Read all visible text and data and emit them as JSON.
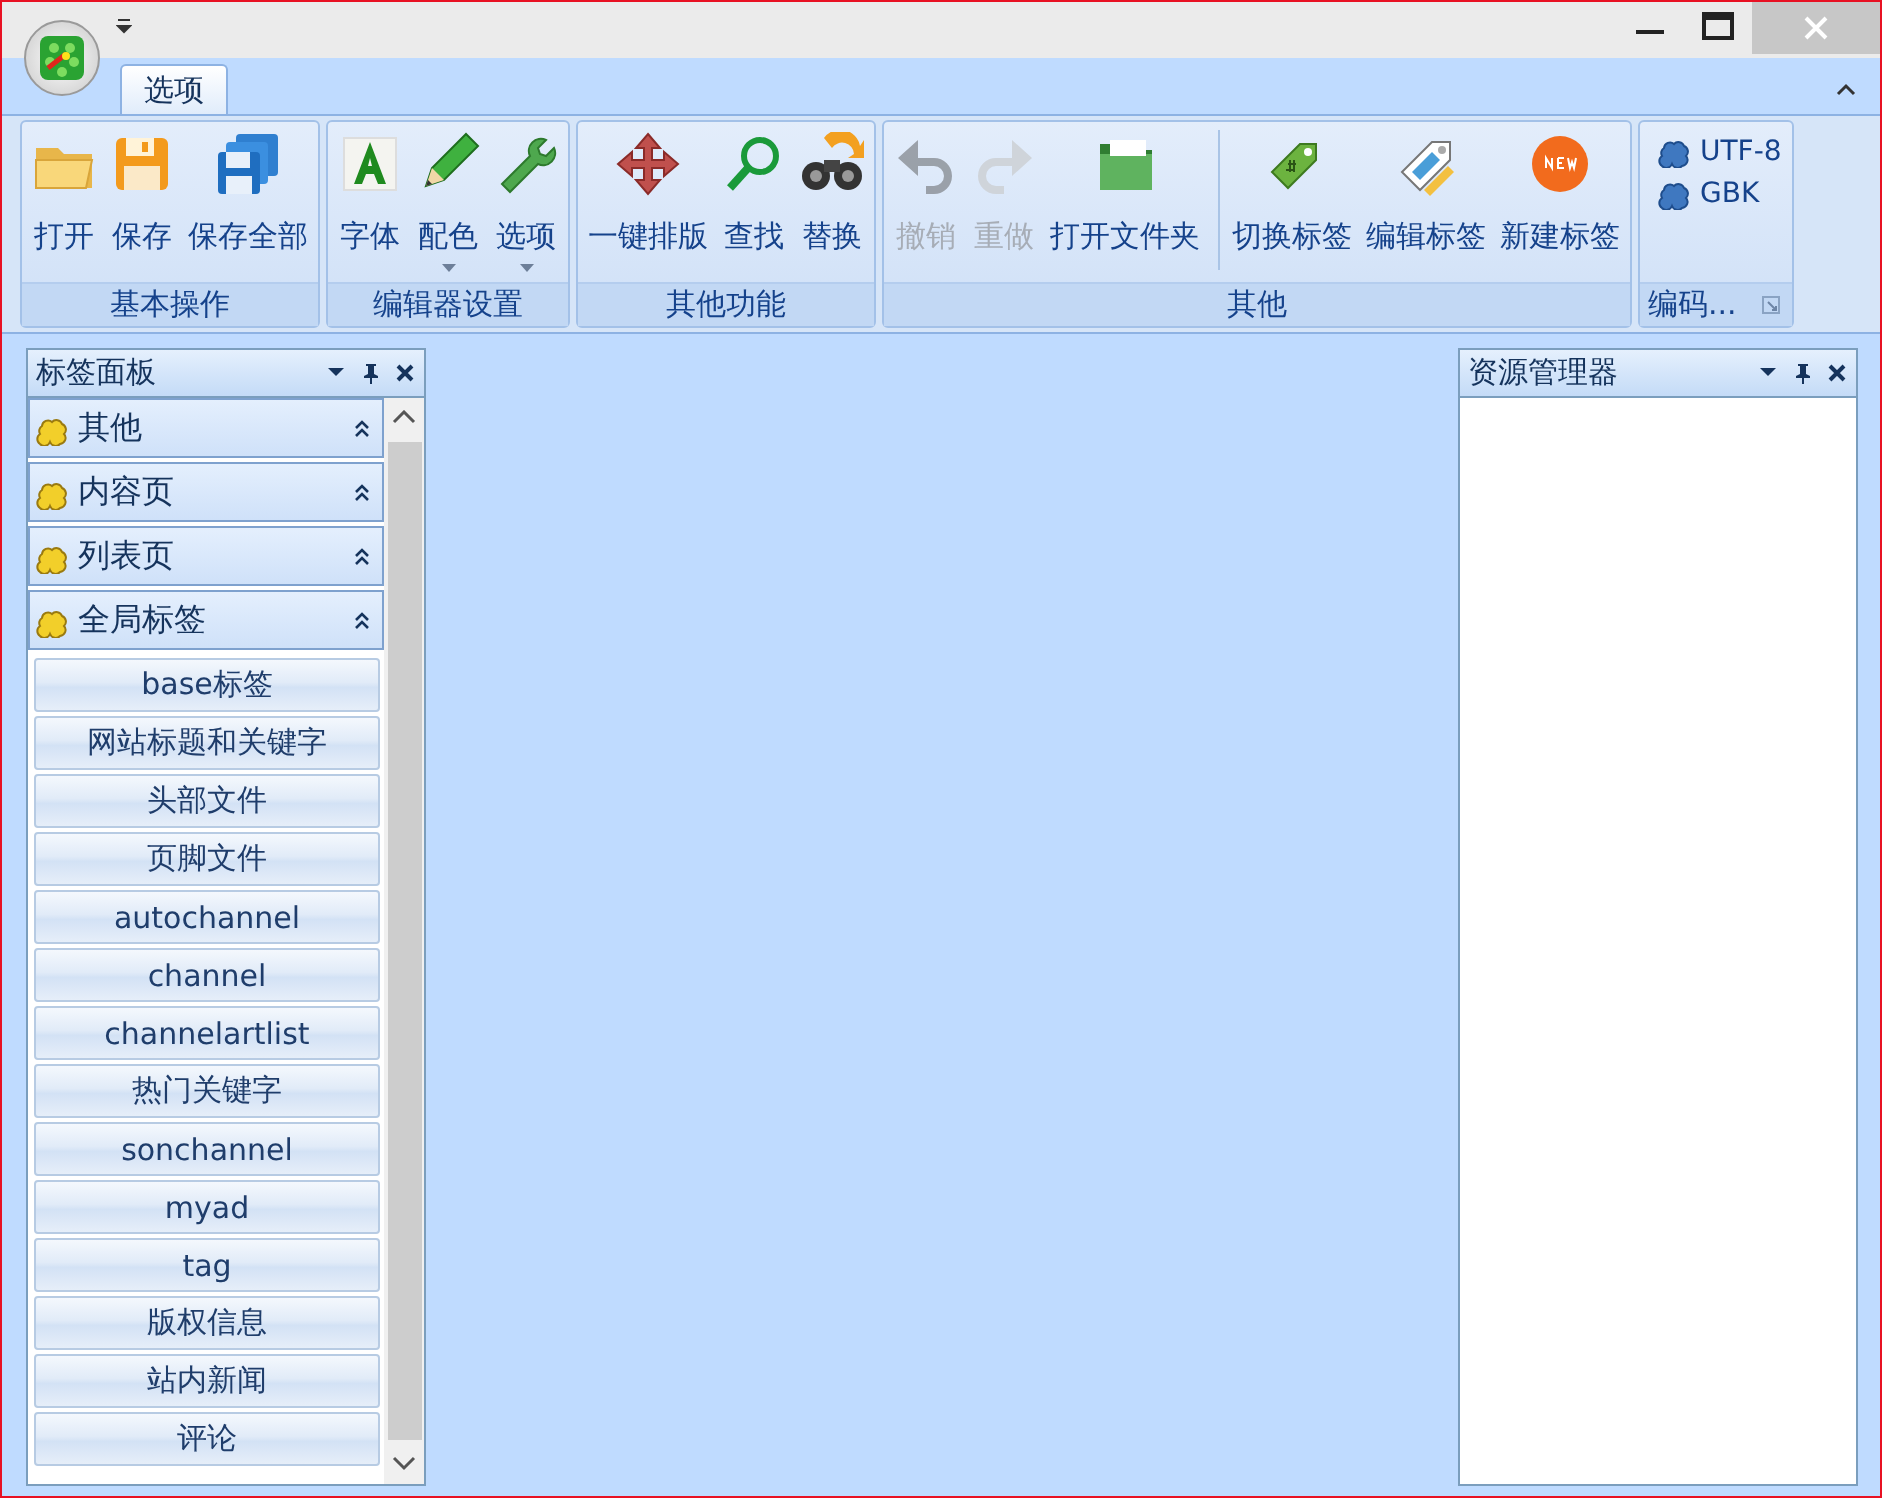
{
  "ribbon": {
    "tabs": [
      {
        "label": "选项",
        "selected": true
      }
    ],
    "groups": [
      {
        "label": "基本操作",
        "buttons": [
          {
            "label": "打开",
            "disabled": false,
            "dropdown": false,
            "separator_before": false
          },
          {
            "label": "保存",
            "disabled": false,
            "dropdown": false,
            "separator_before": false
          },
          {
            "label": "保存全部",
            "disabled": false,
            "dropdown": false,
            "separator_before": false
          }
        ]
      },
      {
        "label": "编辑器设置",
        "buttons": [
          {
            "label": "字体",
            "disabled": false,
            "dropdown": false,
            "separator_before": false
          },
          {
            "label": "配色",
            "disabled": false,
            "dropdown": true,
            "separator_before": false
          },
          {
            "label": "选项",
            "disabled": false,
            "dropdown": true,
            "separator_before": false
          }
        ]
      },
      {
        "label": "其他功能",
        "buttons": [
          {
            "label": "一键排版",
            "disabled": false,
            "dropdown": false,
            "separator_before": false
          },
          {
            "label": "查找",
            "disabled": false,
            "dropdown": false,
            "separator_before": false
          },
          {
            "label": "替换",
            "disabled": false,
            "dropdown": false,
            "separator_before": false
          }
        ]
      },
      {
        "label": "其他",
        "buttons": [
          {
            "label": "撤销",
            "disabled": true,
            "dropdown": false,
            "separator_before": false
          },
          {
            "label": "重做",
            "disabled": true,
            "dropdown": false,
            "separator_before": false
          },
          {
            "label": "打开文件夹",
            "disabled": false,
            "dropdown": false,
            "separator_before": false
          },
          {
            "label": "切换标签",
            "disabled": false,
            "dropdown": false,
            "separator_before": true
          },
          {
            "label": "编辑标签",
            "disabled": false,
            "dropdown": false,
            "separator_before": false
          },
          {
            "label": "新建标签",
            "disabled": false,
            "dropdown": false,
            "separator_before": false
          }
        ]
      }
    ],
    "encoding": {
      "label": "编码...",
      "items": [
        {
          "label": "UTF-8"
        },
        {
          "label": "GBK"
        }
      ]
    }
  },
  "tag_panel": {
    "title": "标签面板",
    "sections": [
      {
        "label": "其他"
      },
      {
        "label": "内容页"
      },
      {
        "label": "列表页"
      },
      {
        "label": "全局标签",
        "items": [
          "base标签",
          "网站标题和关键字",
          "头部文件",
          "页脚文件",
          "autochannel",
          "channel",
          "channelartlist",
          "热门关键字",
          "sonchannel",
          "myad",
          "tag",
          "版权信息",
          "站内新闻",
          "评论"
        ]
      }
    ]
  },
  "explorer_panel": {
    "title": "资源管理器"
  }
}
